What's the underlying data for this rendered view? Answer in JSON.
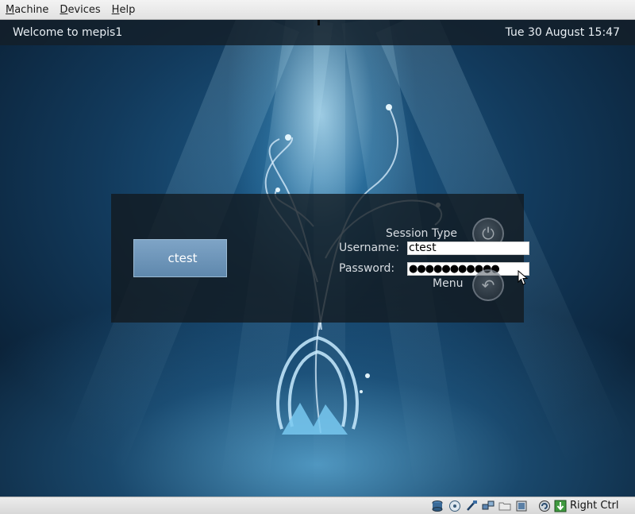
{
  "host_menu": [
    "Machine",
    "Devices",
    "Help"
  ],
  "top_bar": {
    "welcome": "Welcome to mepis1",
    "datetime": "Tue 30 August 15:47"
  },
  "login": {
    "user_tile": "ctest",
    "session_type_label": "Session Type",
    "username_label": "Username:",
    "password_label": "Password:",
    "username_value": "ctest",
    "password_mask": "●●●●●●●●●●●",
    "menu_label": "Menu"
  },
  "status_bar": {
    "icons": [
      "hard-disk-icon",
      "optical-drive-icon",
      "usb-icon",
      "network-icon",
      "shared-folders-icon",
      "display-icon",
      "capture-icon",
      "mouse-integration-icon"
    ],
    "host_key": "Right Ctrl"
  },
  "colors": {
    "panel": "#12181e",
    "user_tile": "#6f97ba",
    "topbar": "#141e28"
  }
}
